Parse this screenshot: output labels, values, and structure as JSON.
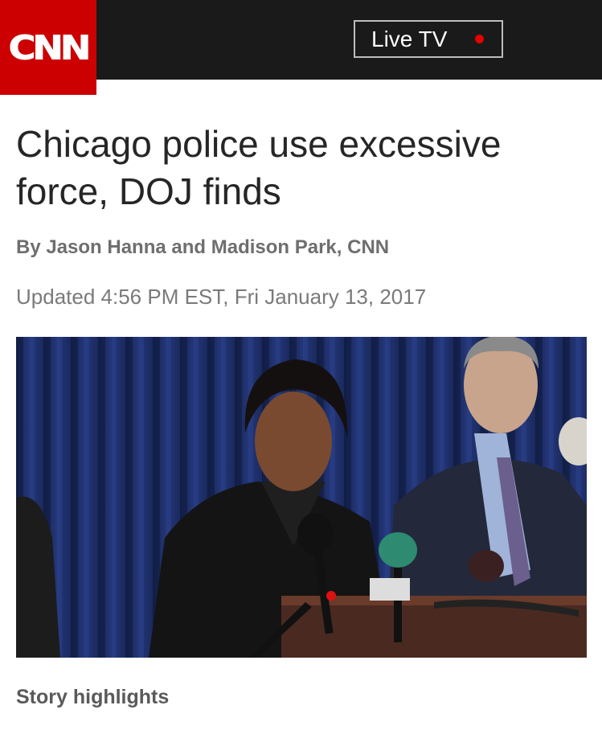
{
  "header": {
    "logo_text": "CNN",
    "live_label": "Live TV",
    "live_dot_color": "#e60000",
    "brand_color": "#cc0000"
  },
  "article": {
    "headline": "Chicago police use excessive force, DOJ finds",
    "byline": "By Jason Hanna and Madison Park, CNN",
    "updated": "Updated 4:56 PM EST, Fri January 13, 2017",
    "story_highlights_label": "Story highlights"
  },
  "photo": {
    "icon": "press-conference-photo"
  }
}
